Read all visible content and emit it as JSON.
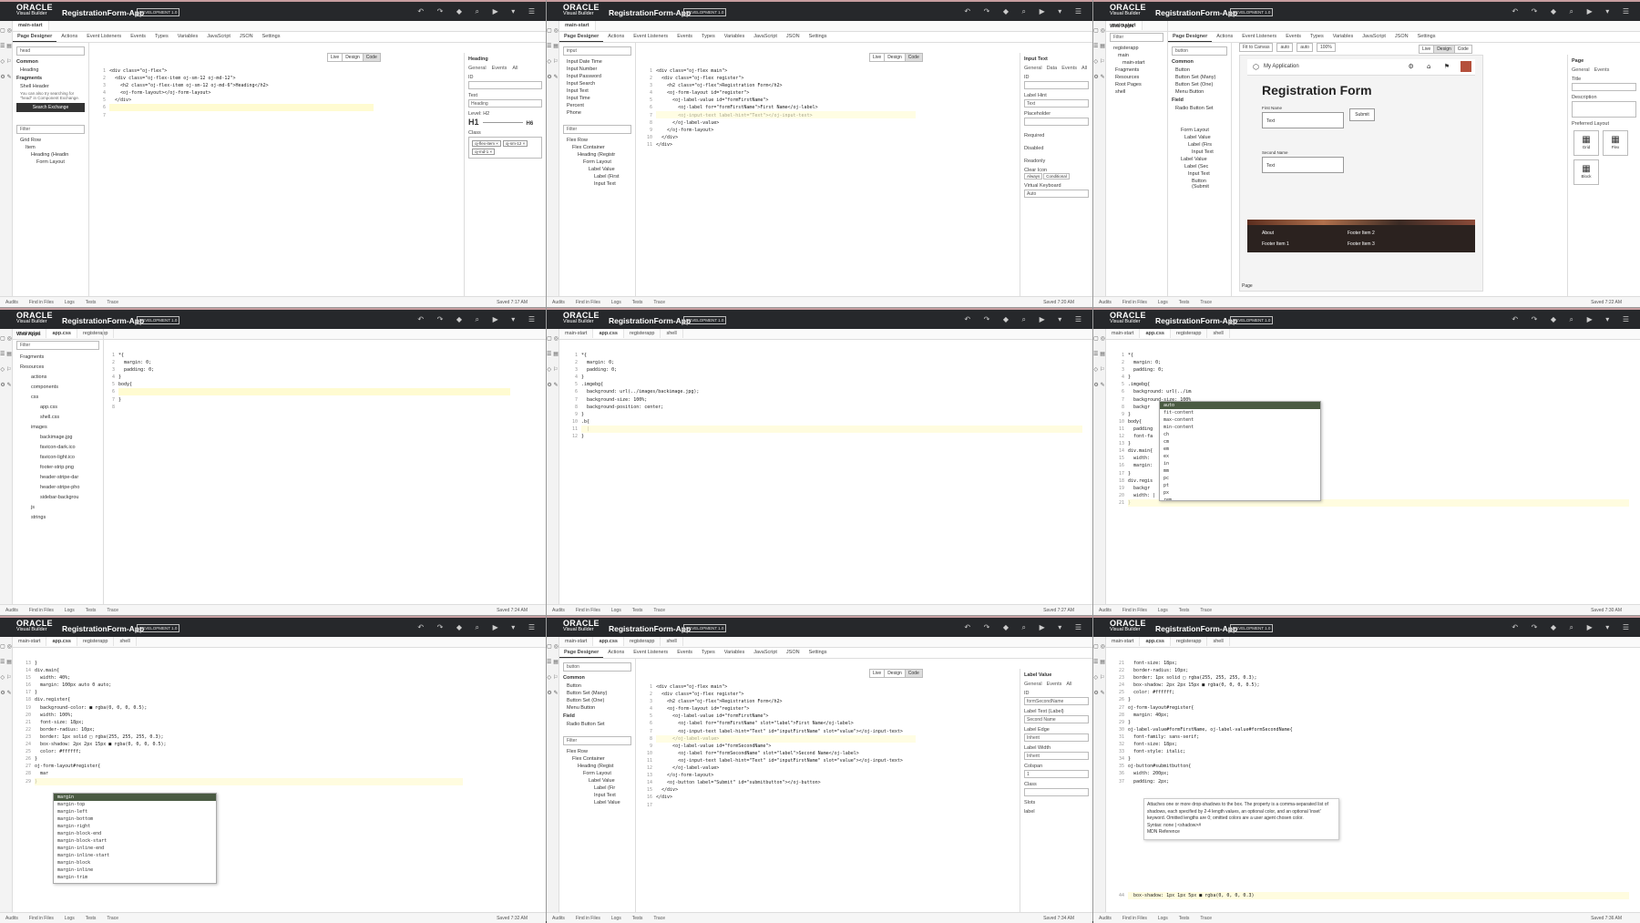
{
  "app": {
    "logo_line1": "ORACLE",
    "logo_line2": "Visual Builder",
    "name": "RegistrationForm-App",
    "badge": "DEVELOPMENT 1.0"
  },
  "toolbar_icons": "↶ ↷ ◆ ⌕ ▶ ▾ ☰",
  "rail_icons": "▢ ◎ ☰ ▤ ◇ ⚐ ⚙ ✎",
  "bottom": {
    "audits": "Audits",
    "find": "Find in Files",
    "logs": "Logs",
    "tests": "Tests",
    "trace": "Trace"
  },
  "designer_tabs": [
    "Page Designer",
    "Actions",
    "Event Listeners",
    "Events",
    "Types",
    "Variables",
    "JavaScript",
    "JSON",
    "Settings"
  ],
  "modes": [
    "Live",
    "Design",
    "Code"
  ],
  "panels": [
    {
      "saved": "Saved 7:17 AM",
      "tabs": [
        "main-start"
      ],
      "search": "head",
      "common": "Common",
      "item_heading": "Heading",
      "fragments": "Fragments",
      "item_shell_header": "Shell Header",
      "exchange_text": "You can also try searching for \"head\" in Component Exchange.",
      "exchange_button": "Search Exchange",
      "filter": "Filter",
      "tree": [
        "Grid Row",
        "Item",
        "Heading (Headin",
        "Form Layout"
      ],
      "code": "<div class=\"oj-flex\">\n  <div class=\"oj-flex-item oj-sm-12 oj-md-12\">\n    <h2 class=\"oj-flex-item oj-sm-12 oj-md-6\">Heading</h2>\n    <oj-form-layout></oj-form-layout>\n  </div>\n</div>",
      "props_title": "Heading",
      "props_tabs": [
        "General",
        "Events",
        "All"
      ],
      "id_label": "ID",
      "text_label": "Text",
      "text_value": "Heading",
      "level_label": "Level: H2",
      "level_min": "H1",
      "level_max": "H6",
      "class_label": "Class",
      "class_chips": [
        "oj-flex-item ×",
        "oj-sm-12 ×",
        "oj-md-1 ×"
      ]
    },
    {
      "saved": "Saved 7:20 AM",
      "tabs": [
        "main-start"
      ],
      "search": "input",
      "items": [
        "Input Date Time",
        "Input Number",
        "Input Password",
        "Input Search",
        "Input Text",
        "Input Time",
        "Percent",
        "Phone"
      ],
      "filter": "Filter",
      "tree": [
        "Flex Row",
        "Flex Container",
        "Heading (Registr",
        "Form Layout",
        "Label Value",
        "Label (First",
        "Input Text"
      ],
      "code": "<div class=\"oj-flex main\">\n  <div class=\"oj-flex register\">\n    <h2 class=\"oj-flex\">Registration Form</h2>\n    <oj-form-layout id=\"register\">\n      <oj-label-value id=\"formFirstName\">\n        <oj-label for=\"formFirstName\">First Name</oj-label>\n        <oj-input-text label-hint=\"Text\"></oj-input-text>\n      </oj-label-value>\n    </oj-form-layout>\n  </div>\n</div>",
      "props_title": "Input Text",
      "props_tabs": [
        "General",
        "Data",
        "Events",
        "All"
      ],
      "id_label": "ID",
      "label_hint": "Label Hint",
      "label_hint_value": "Text",
      "placeholder": "Placeholder",
      "required": "Required",
      "disabled": "Disabled",
      "readonly": "Readonly",
      "clear_icon": "Clear Icon",
      "clear_opts": [
        "Always",
        "Conditional"
      ],
      "virtual_keyboard": "Virtual Keyboard",
      "vk_value": "Auto"
    },
    {
      "saved": "Saved 7:22 AM",
      "tabs": [
        "main-start"
      ],
      "web_apps": "Web Apps",
      "filter": "Filter",
      "tree": [
        "registerapp",
        "main",
        "main-start",
        "Fragments",
        "Resources",
        "Root Pages",
        "shell"
      ],
      "search": "button",
      "items": [
        "Button",
        "Button Set (Many)",
        "Button Set (One)",
        "Menu Button"
      ],
      "field": "Field",
      "radio": "Radio Button Set",
      "tree2": [
        "Form Layout",
        "Label Value",
        "Label (Firs",
        "Input Text",
        "Label Value",
        "Label (Sec",
        "Input Text",
        "Button (Submit"
      ],
      "canvas_toolbar": [
        "Fit to Canvas",
        "auto",
        "auto",
        "100%"
      ],
      "preview": {
        "app_title": "My Application",
        "form_title": "Registration Form",
        "first_name": "First Name",
        "second_name": "Second Name",
        "text_ph": "Text",
        "submit": "Submit",
        "footer": [
          "About",
          "Footer Item 2",
          "Footer Item 1",
          "Footer Item 3"
        ]
      },
      "page_label": "Page",
      "props_title": "Page",
      "props_tabs": [
        "General",
        "Events"
      ],
      "title_label": "Title",
      "desc_label": "Description",
      "layout_label": "Preferred Layout",
      "layouts": [
        "Grid",
        "Flex",
        "Block"
      ]
    },
    {
      "saved": "Saved 7:24 AM",
      "tabs": [
        "main-start",
        "app.css",
        "registerapp"
      ],
      "web_apps": "Web Apps",
      "filter": "Filter",
      "tree": [
        "Fragments",
        "Resources",
        "actions",
        "components",
        "css",
        "app.css",
        "shell.css",
        "images",
        "backimage.jpg",
        "favicon-dark.ico",
        "favicon-light.ico",
        "footer-strip.png",
        "header-stripe-dar",
        "header-stripe-pho",
        "sidebar-backgrou",
        "js",
        "strings"
      ],
      "code": "*{\n  margin: 0;\n  padding: 0;\n}\nbody{\n  background: url(../imag\n}"
    },
    {
      "saved": "Saved 7:27 AM",
      "tabs": [
        "main-start",
        "app.css",
        "registerapp",
        "shell"
      ],
      "code": "*{\n  margin: 0;\n  padding: 0;\n}\n.imgebg{\n  background: url(../images/backimage.jpg);\n  background-size: 100%;\n  background-position: center;\n}\n.b{\n  |\n}"
    },
    {
      "saved": "Saved 7:30 AM",
      "tabs": [
        "main-start",
        "app.css",
        "registerapp",
        "shell"
      ],
      "code": "*{\n  margin: 0;\n  padding: 0;\n}\n.imgebg{\n  background: url(../images/backimage.jpg);\n  background-size: 100%;\n  backgr\n}\nbody{\n  padding\n  font-fa\n}\ndiv.main{\n  width:\n  margin:\n}\ndiv.regis\n  backgr\n  width: |\n}",
      "ac": [
        "auto",
        "fit-content",
        "max-content",
        "min-content",
        "ch",
        "cm",
        "em",
        "ex",
        "in",
        "mm",
        "pc",
        "pt",
        "px",
        "rem",
        "vh",
        "vw"
      ]
    },
    {
      "saved": "Saved 7:32 AM",
      "tabs": [
        "main-start",
        "app.css",
        "registerapp",
        "shell"
      ],
      "code": "}\ndiv.main{\n  width: 40%;\n  margin: 100px auto 0 auto;\n}\ndiv.register{\n  background-color: ■ rgba(0, 0, 0, 0.5);\n  width: 100%;\n  font-size: 18px;\n  border-radius: 10px;\n  border: 1px solid □ rgba(255, 255, 255, 0.3);\n  box-shadow: 2px 2px 15px ■ rgba(0, 0, 0, 0.5);\n  color: #ffffff;\n}\noj-form-layout#register{\n  mar\n}",
      "ac": [
        "margin",
        "margin-top",
        "margin-left",
        "margin-bottom",
        "margin-right",
        "margin-block-end",
        "margin-block-start",
        "margin-inline-end",
        "margin-inline-start",
        "margin-block",
        "margin-inline",
        "margin-trim"
      ]
    },
    {
      "saved": "Saved 7:34 AM",
      "tabs": [
        "main-start",
        "app.css",
        "registerapp",
        "shell"
      ],
      "search": "button",
      "items": [
        "Button",
        "Button Set (Many)",
        "Button Set (One)",
        "Menu Button"
      ],
      "field": "Field",
      "radio": "Radio Button Set",
      "filter": "Filter",
      "tree": [
        "Flex Row",
        "Flex Container",
        "Heading (Regist",
        "Form Layout",
        "Label Value",
        "Label (Fir",
        "Input Text",
        "Label Value"
      ],
      "code": "<div class=\"oj-flex main\">\n  <div class=\"oj-flex register\">\n    <h2 class=\"oj-flex\">Registration Form</h2>\n    <oj-form-layout id=\"register\">\n      <oj-label-value id=\"formFirstName\">\n        <oj-label for=\"formFirstName\" slot=\"label\">First Name</oj-label>\n        <oj-input-text label-hint=\"Text\" id=\"inputFirstName\" slot=\"value\"></oj-input-text>\n      </oj-label-value>\n      <oj-label-value id=\"formSecondName\">\n        <oj-label for=\"formSecondName\" slot=\"label\">Second Name</oj-label>\n        <oj-input-text label-hint=\"Text\" id=\"inputFirstName\" slot=\"value\"></oj-input-text>\n      </oj-label-value>\n    </oj-form-layout>\n    <oj-button label=\"Submit\" id=\"submitbutton\"></oj-button>\n  </div>\n</div>",
      "props_title": "Label Value",
      "props_tabs": [
        "General",
        "Events",
        "All"
      ],
      "id_label": "ID",
      "id_value": "formSecondName",
      "label_text": "Label Text (Label)",
      "label_text_value": "Second Name",
      "label_edge": "Label Edge",
      "label_edge_value": "Inherit",
      "label_width": "Label Width",
      "label_width_value": "Inherit",
      "colspan": "Colspan",
      "colspan_value": "1",
      "class_label": "Class",
      "slots": "Slots",
      "slot_label": "label"
    },
    {
      "saved": "Saved 7:36 AM",
      "tabs": [
        "main-start",
        "app.css",
        "registerapp",
        "shell"
      ],
      "code": "  font-size: 18px;\n  border-radius: 10px;\n  border: 1px solid □ rgba(255, 255, 255, 0.3);\n  box-shadow: 2px 2px 15px ■ rgba(0, 0, 0, 0.5);\n  color: #ffffff;\n}\noj-form-layout#register{\n  margin: 40px;\n}\noj-label-value#formFirstName, oj-label-value#formSecondName{\n  font-family: sans-serif;\n  font-size: 18px;\n  font-style: italic;\n}\noj-button#submitbutton{\n  width: 200px;\n  padding: 2px;",
      "tip": "Attaches one or more drop-shadows to the box. The property is a comma-separated list of shadows, each specified by 2-4 length values, an optional color, and an optional 'inset' keyword. Omitted lengths are 0; omitted colors are a user agent chosen color.\nSyntax: none | <shadow>#\nMDN Reference",
      "last_line": "  box-shadow: 1px 1px 5px ■ rgba(0, 0, 0, 0.3)"
    }
  ]
}
